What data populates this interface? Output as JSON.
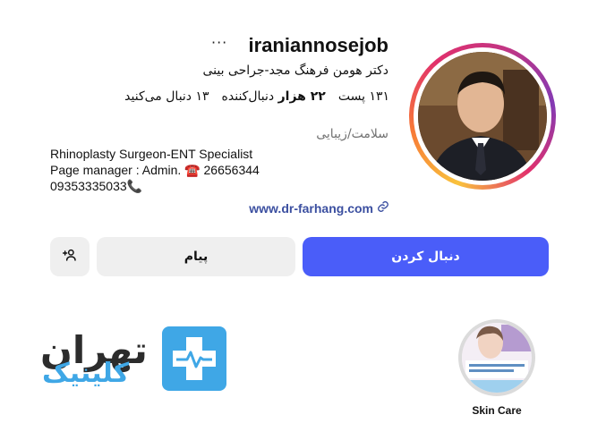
{
  "profile": {
    "username": "iraniannosejob",
    "more_label": "···",
    "full_name": "دکتر هومن فرهنگ مجد-جراحی بینی",
    "stats": {
      "posts_count": "۱۳۱",
      "posts_label": "پست",
      "followers_count": "۲۲ هزار",
      "followers_label": "دنبال‌کننده",
      "following_count": "۱۳",
      "following_label": "دنبال می‌کنید"
    },
    "category": "سلامت/زیبایی",
    "bio_lines": {
      "line1": "Rhinoplasty Surgeon-ENT Specialist",
      "line2": "Page manager : Admin. ☎️ 26656344",
      "line3": "09353335033📞"
    },
    "website": "www.dr-farhang.com"
  },
  "actions": {
    "follow_label": "دنبال کردن",
    "message_label": "پیام"
  },
  "highlights": [
    {
      "label": "Skin Care"
    }
  ],
  "watermark": {
    "top": "تهران",
    "bottom": "کلینیک"
  },
  "colors": {
    "follow_button": "#4a5df9",
    "secondary_button": "#efefef",
    "link": "#3b4fa0",
    "watermark_blue": "#3fa7e6"
  },
  "icons": {
    "more": "more-icon",
    "link": "link-icon",
    "add_person": "add-person-icon"
  }
}
